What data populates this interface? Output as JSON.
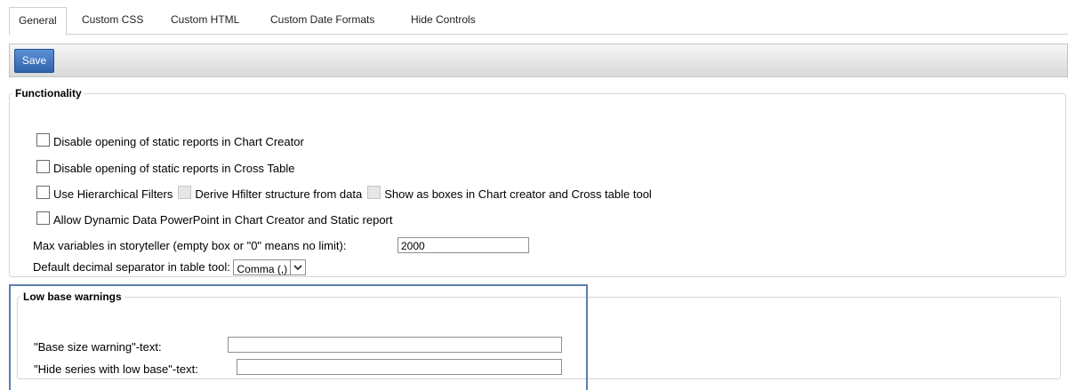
{
  "tabs": [
    {
      "label": "General",
      "active": true
    },
    {
      "label": "Custom CSS"
    },
    {
      "label": "Custom HTML"
    },
    {
      "label": "Custom Date Formats"
    },
    {
      "label": "Hide Controls"
    }
  ],
  "toolbar": {
    "save_label": "Save"
  },
  "functionality": {
    "legend": "Functionality",
    "options": [
      {
        "label": "Disable opening of static reports in Chart Creator",
        "checked": false
      },
      {
        "label": "Disable opening of static reports in Cross Table",
        "checked": false
      },
      {
        "label": "Use Hierarchical Filters",
        "checked": false
      },
      {
        "label": "Derive Hfilter structure from data",
        "checked": false,
        "disabled": true
      },
      {
        "label": "Show as boxes in Chart creator and Cross table tool",
        "checked": false,
        "disabled": true
      },
      {
        "label": "Allow Dynamic Data PowerPoint in Chart Creator and Static report",
        "checked": false
      }
    ],
    "max_vars_label": "Max variables in storyteller (empty box or \"0\" means no limit):",
    "max_vars_value": "2000",
    "decimal_label": "Default decimal separator in table tool:",
    "decimal_value": "Comma (,)"
  },
  "low_base": {
    "legend": "Low base warnings",
    "base_size_label": "\"Base size warning\"-text:",
    "base_size_value": "",
    "hide_series_label": "\"Hide series with low base\"-text:",
    "hide_series_value": ""
  },
  "colors": {
    "accent": "#2e63ab",
    "highlight": "#5b80ad"
  },
  "icons": {
    "select_arrow": "chevron-down-icon"
  }
}
